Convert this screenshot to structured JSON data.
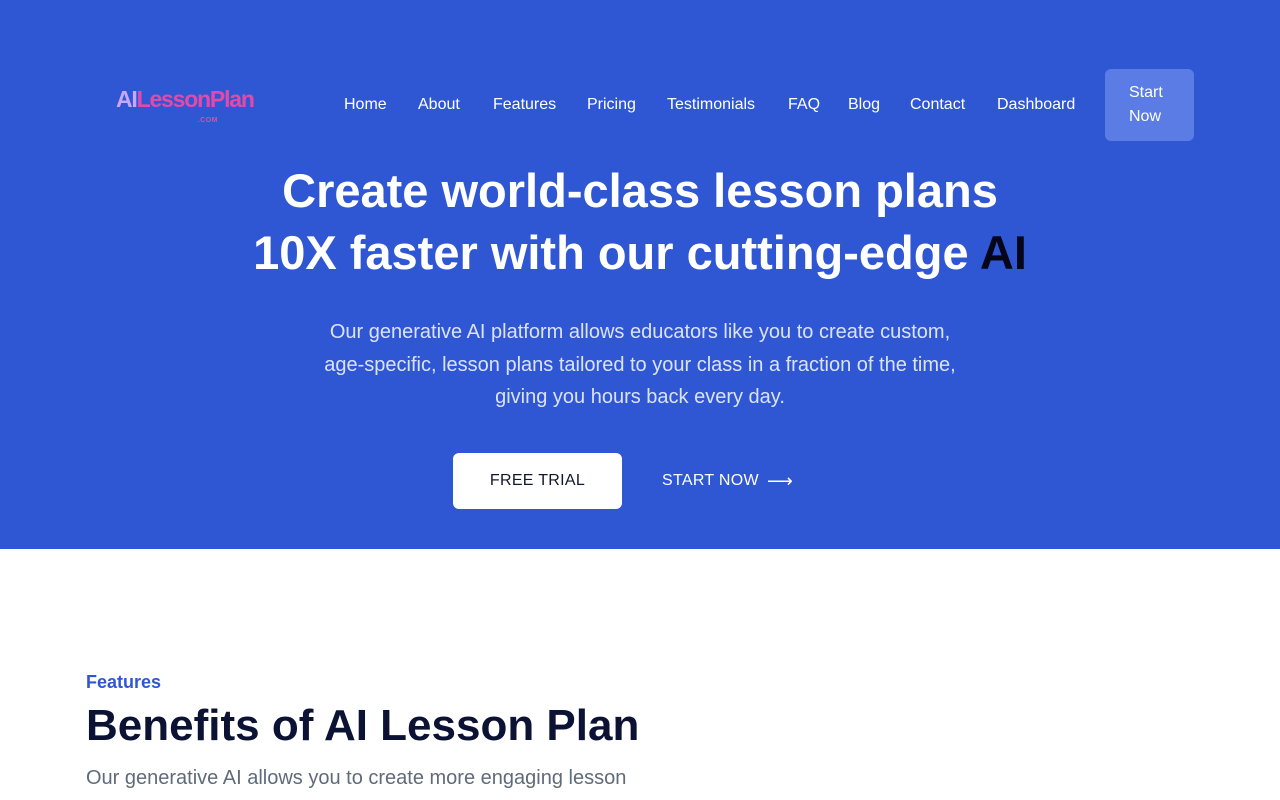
{
  "header": {
    "logo": {
      "mark_ai": "AI",
      "mark_rest": "LessonPlan",
      "dotcom": ".COM"
    },
    "nav": [
      {
        "label": "Home"
      },
      {
        "label": "About"
      },
      {
        "label": "Features"
      },
      {
        "label": "Pricing"
      },
      {
        "label": "Testimonials"
      },
      {
        "label": "FAQ"
      },
      {
        "label": "Blog"
      },
      {
        "label": "Contact"
      },
      {
        "label": "Dashboard"
      }
    ],
    "cta_label": "Start Now"
  },
  "hero": {
    "headline_line1": "Create world-class lesson plans",
    "headline_line2_prefix": "10X faster with our cutting-edge ",
    "headline_accent": "AI",
    "subheadline": "Our generative AI platform allows educators like you to create custom, age-specific, lesson plans tailored to your class in a fraction of the time, giving you hours back every day.",
    "primary_button": "FREE TRIAL",
    "secondary_button": "START NOW",
    "secondary_icon": "arrow-right-icon"
  },
  "features": {
    "eyebrow": "Features",
    "title": "Benefits of AI Lesson Plan",
    "description": "Our generative AI allows you to create more engaging lesson"
  },
  "colors": {
    "hero_background": "#2f57d4",
    "cta_background": "#5a7ce4",
    "heading_dark": "#0b1233",
    "accent_text": "#06061a",
    "brand_pink": "#e24aa8"
  }
}
